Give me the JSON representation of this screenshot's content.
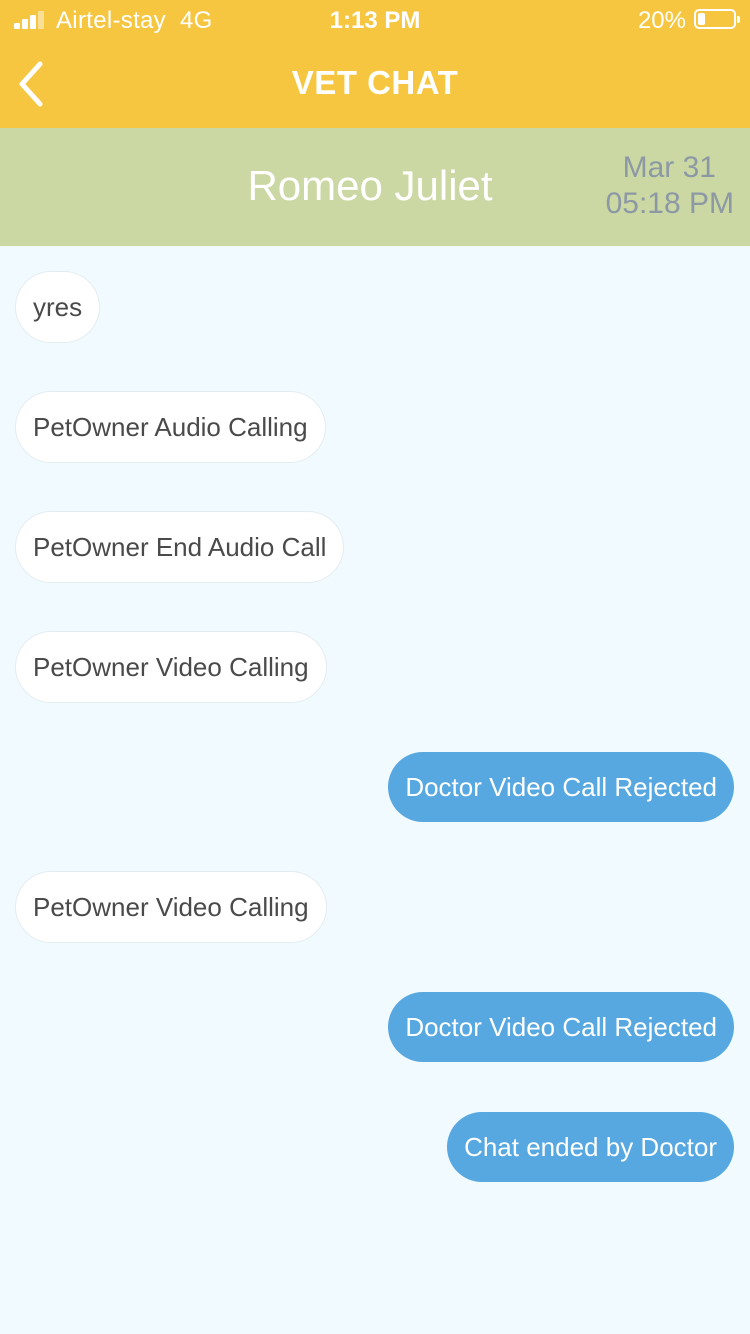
{
  "status_bar": {
    "carrier": "Airtel-stay",
    "network": "4G",
    "time": "1:13 PM",
    "battery_percent": "20%",
    "battery_level": 0.2
  },
  "nav": {
    "back_icon": "chevron-left-icon",
    "title": "VET CHAT"
  },
  "contact": {
    "name": "Romeo Juliet",
    "date": "Mar 31",
    "time": "05:18 PM"
  },
  "messages": [
    {
      "text": "yres",
      "direction": "in"
    },
    {
      "text": "PetOwner Audio Calling",
      "direction": "in"
    },
    {
      "text": "PetOwner End Audio Call",
      "direction": "in"
    },
    {
      "text": "PetOwner Video Calling",
      "direction": "in"
    },
    {
      "text": "Doctor Video Call Rejected",
      "direction": "out"
    },
    {
      "text": "PetOwner Video Calling",
      "direction": "in"
    },
    {
      "text": "Doctor Video Call Rejected",
      "direction": "out"
    },
    {
      "text": "Chat ended by Doctor",
      "direction": "out"
    }
  ],
  "colors": {
    "header_yellow": "#F6C640",
    "contact_green": "#CBD8A4",
    "outgoing_bubble": "#57A8E0",
    "incoming_bubble": "#FFFFFF",
    "background": "#F1FAFE"
  }
}
